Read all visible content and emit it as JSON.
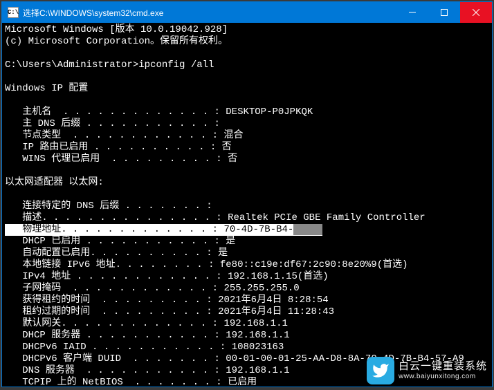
{
  "window": {
    "title": "选择C:\\WINDOWS\\system32\\cmd.exe"
  },
  "banner": {
    "line1": "Microsoft Windows [版本 10.0.19042.928]",
    "line2": "(c) Microsoft Corporation。保留所有权利。"
  },
  "prompt": {
    "path": "C:\\Users\\Administrator>",
    "command": "ipconfig /all"
  },
  "sections": {
    "ip_config_header": "Windows IP 配置",
    "host": {
      "labels": {
        "hostname": "主机名",
        "primary_dns_suffix": "主 DNS 后缀",
        "node_type": "节点类型",
        "ip_routing": "IP 路由已启用",
        "wins_proxy": "WINS 代理已启用"
      },
      "values": {
        "hostname": "DESKTOP-P0JPKQK",
        "primary_dns_suffix": "",
        "node_type": "混合",
        "ip_routing": "否",
        "wins_proxy": "否"
      }
    },
    "adapter_header": "以太网适配器 以太网:",
    "adapter": {
      "labels": {
        "conn_dns_suffix": "连接特定的 DNS 后缀",
        "description": "描述",
        "physical_address": "物理地址",
        "dhcp_enabled": "DHCP 已启用",
        "autoconfig_enabled": "自动配置已启用",
        "link_local_ipv6": "本地链接 IPv6 地址",
        "ipv4_address": "IPv4 地址",
        "subnet_mask": "子网掩码",
        "lease_obtained": "获得租约的时间",
        "lease_expires": "租约过期的时间",
        "default_gateway": "默认网关",
        "dhcp_server": "DHCP 服务器",
        "dhcpv6_iaid": "DHCPv6 IAID",
        "dhcpv6_duid": "DHCPv6 客户端 DUID",
        "dns_servers": "DNS 服务器",
        "tcpip_netbios": "TCPIP 上的 NetBIOS"
      },
      "values": {
        "conn_dns_suffix": "",
        "description": "Realtek PCIe GBE Family Controller",
        "physical_address_visible": "70-4D-7B-B4-",
        "dhcp_enabled": "是",
        "autoconfig_enabled": "是",
        "link_local_ipv6": "fe80::c19e:df67:2c90:8e20%9(首选)",
        "ipv4_address": "192.168.1.15(首选)",
        "subnet_mask": "255.255.255.0",
        "lease_obtained": "2021年6月4日 8:28:54",
        "lease_expires": "2021年6月4日 11:28:43",
        "default_gateway": "192.168.1.1",
        "dhcp_server": "192.168.1.1",
        "dhcpv6_iaid": "108023163",
        "dhcpv6_duid": "00-01-00-01-25-AA-D8-8A-70-4D-7B-B4-57-A9",
        "dns_servers": "192.168.1.1",
        "tcpip_netbios": "已启用"
      }
    }
  },
  "watermark": {
    "cn": "白云一键重装系统",
    "url": "www.baiyunxitong.com"
  }
}
